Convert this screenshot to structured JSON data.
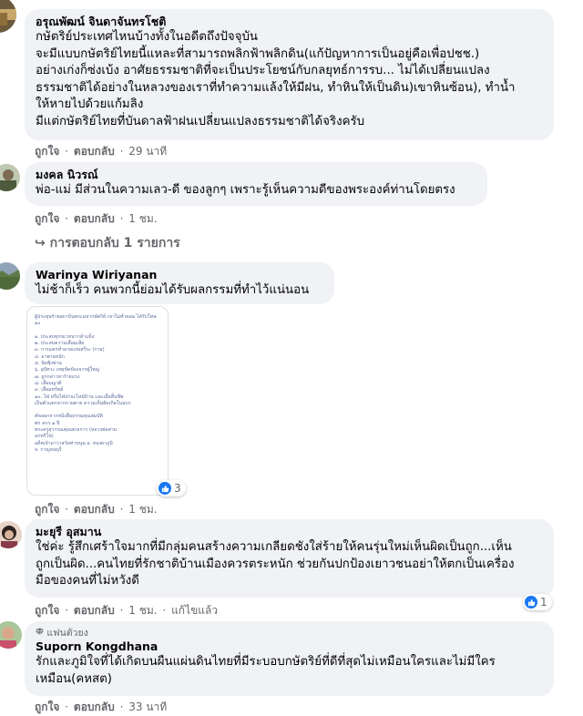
{
  "comments": [
    {
      "author": "อรุณพัฒน์ จินดาจันทรโชติ",
      "text": "กษัตริย์ประเทศไหนบ้างทั้งในอดีตถึงปัจจุบัน\nจะมีแบบกษัตริย์ไทยนี้แหละที่สามารถพลิกฟ้าพลิกดิน(แก้ปัญหาการเป็นอยู่คือเพื่อปชช.)\nอย่างเก่งก็ซ่งเบ้ง อาศัยธรรมชาติที่จะเป็นประโยชน์กับกลยุทธ์การรบ... ไม่ได้เปลี่ยนแปลง\nธรรมชาติได้อย่างในหลวงของเราที่ทำความแล้งให้มีฝน, ทำหินให้เป็นดิน)เขาหินซ้อน), ทำน้ำ\nให้หายไปด้วยแก้มลิง\nมีแต่กษัตริย์ไทยที่บันดาลฟ้าฝนเปลี่ยนแปลงธรรมชาติได้จริงครับ",
      "like": "ถูกใจ",
      "reply": "ตอบกลับ",
      "time": "29 นาที"
    },
    {
      "author": "มงคล นิวรณ์",
      "text": "พ่อ-แม่ มีส่วนในความเลว-ดี ของลูกๆ เพราะรู้เห็นความดีของพระองค์ท่านโดยตรง",
      "like": "ถูกใจ",
      "reply": "ตอบกลับ",
      "time": "1 ชม.",
      "replies_link": "↪ การตอบกลับ 1 รายการ"
    },
    {
      "author": "Warinya Wiriyanan",
      "text": "ไม่ช้าก็เร็ว คนพวกนี้ย่อมได้รับผลกรรมที่ทำไว้แน่นอน",
      "like": "ถูกใจ",
      "reply": "ตอบกลับ",
      "time": "1 ชม.",
      "reaction_count": "3",
      "attachment_text": "ผู้ประทุษร้ายสถาบันพระมหากษัตริย์ เขาไม่ทำคอม ได้รับโทษ ๑๐\n\n๑. ประสบทุกขเวทนากล้าแข็ง\n๒. ประสบความเสื่อมเสีย\n๓. การแตกทำลายแห่งสรีระ (กาย)\n๔. อาพาธหนัก\n๕. จิตฟุ้งซ่าน\n๖. อุปัทวะ เหตุขัดข้องจากผู้ใหญ่\n๗. ถูกกล่าวหาร้ายแรง\n๘. เสื่อมญาติ\n๙. เสื่อมทรัพย์\n๑๐. ไฟ หรือไฟป่าจะไหม้บ้าน และเมื่อสิ้นชีพ\nเป็นตัวแตกจากกายตาย ความเห็นผิดเกิดในนรก\n\nคัดลอกจากหนังสือธรรมคุณสมบัติ\nศก คกร ๑ ปี\nพระครูสุวรรณคุณสกลการ (หลวงพ่อสาม\nอกทริโช)\nอดีตเจ้าอาวาสวัดท่าขนุน อ. ทองผาภูมิ\nจ. กาญจนบุรี"
    },
    {
      "author": "มะยุรี อุสมาน",
      "text": "ใช่ค่ะ รู้สึกเศร้าใจมากที่มีกลุ่มคนสร้างความเกลียดชังใส่ร้ายให้คนรุ่นใหม่เห็นผิดเป็นถูก...เห็น\nถูกเป็นผิด...คนไทยที่รักชาติบ้านเมืองควรตระหนัก ช่วยกันปกป้องเยาวชนอย่าให้ตกเป็นเครื่อง\nมือของคนที่ไม่หวังดี",
      "like": "ถูกใจ",
      "reply": "ตอบกลับ",
      "time": "1 ชม.",
      "edited": "แก้ไขแล้ว",
      "reaction_count": "1"
    },
    {
      "badge": "แฟนตัวยง",
      "author": "Suporn Kongdhana",
      "text": "รักและภูมิใจที่ได้เกิดบนผืนแผ่นดินไทยที่มีระบอบกษัตริย์ที่ดีที่สุดไม่เหมือนใครและไม่มีใคร\nเหมือน(คหสต)",
      "like": "ถูกใจ",
      "reply": "ตอบกลับ",
      "time": "33 นาที"
    }
  ],
  "colors": {
    "bubble": "#f0f2f5",
    "meta_text": "#65676b",
    "like_blue": "#1877f2"
  },
  "icons": {
    "like": "thumbs-up-icon",
    "fan_badge": "diamond-icon",
    "reply_arrow": "reply-arrow-icon"
  }
}
